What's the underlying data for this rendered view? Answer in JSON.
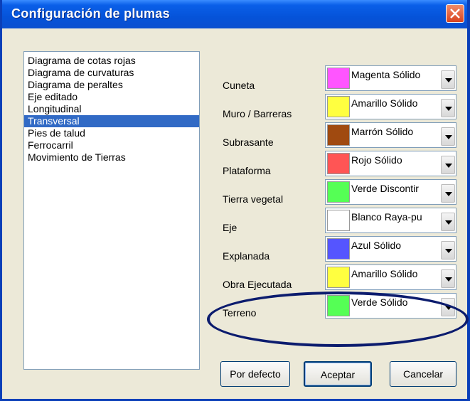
{
  "window": {
    "title": "Configuración de plumas"
  },
  "list": {
    "items": [
      "Diagrama de cotas rojas",
      "Diagrama de curvaturas",
      "Diagrama de peraltes",
      "Eje editado",
      "Longitudinal",
      "Transversal",
      "Pies de talud",
      "Ferrocarril",
      "Movimiento de Tierras"
    ],
    "selected": "Transversal"
  },
  "pens": [
    {
      "label": "Cuneta",
      "value": "Magenta Sólido",
      "color": "#ff55ff"
    },
    {
      "label": "Muro / Barreras",
      "value": "Amarillo Sólido",
      "color": "#ffff40"
    },
    {
      "label": "Subrasante",
      "value": "Marrón Sólido",
      "color": "#a04a10"
    },
    {
      "label": "Plataforma",
      "value": "Rojo Sólido",
      "color": "#ff5555"
    },
    {
      "label": "Tierra vegetal",
      "value": "Verde Discontir",
      "color": "#55ff55"
    },
    {
      "label": "Eje",
      "value": "Blanco Raya-pu",
      "color": "#ffffff"
    },
    {
      "label": "Explanada",
      "value": "Azul Sólido",
      "color": "#5555ff"
    },
    {
      "label": "Obra Ejecutada",
      "value": "Amarillo Sólido",
      "color": "#ffff40"
    },
    {
      "label": "Terreno",
      "value": "Verde Sólido",
      "color": "#55ff55"
    }
  ],
  "buttons": {
    "defaults": "Por defecto",
    "accept": "Aceptar",
    "cancel": "Cancelar"
  }
}
